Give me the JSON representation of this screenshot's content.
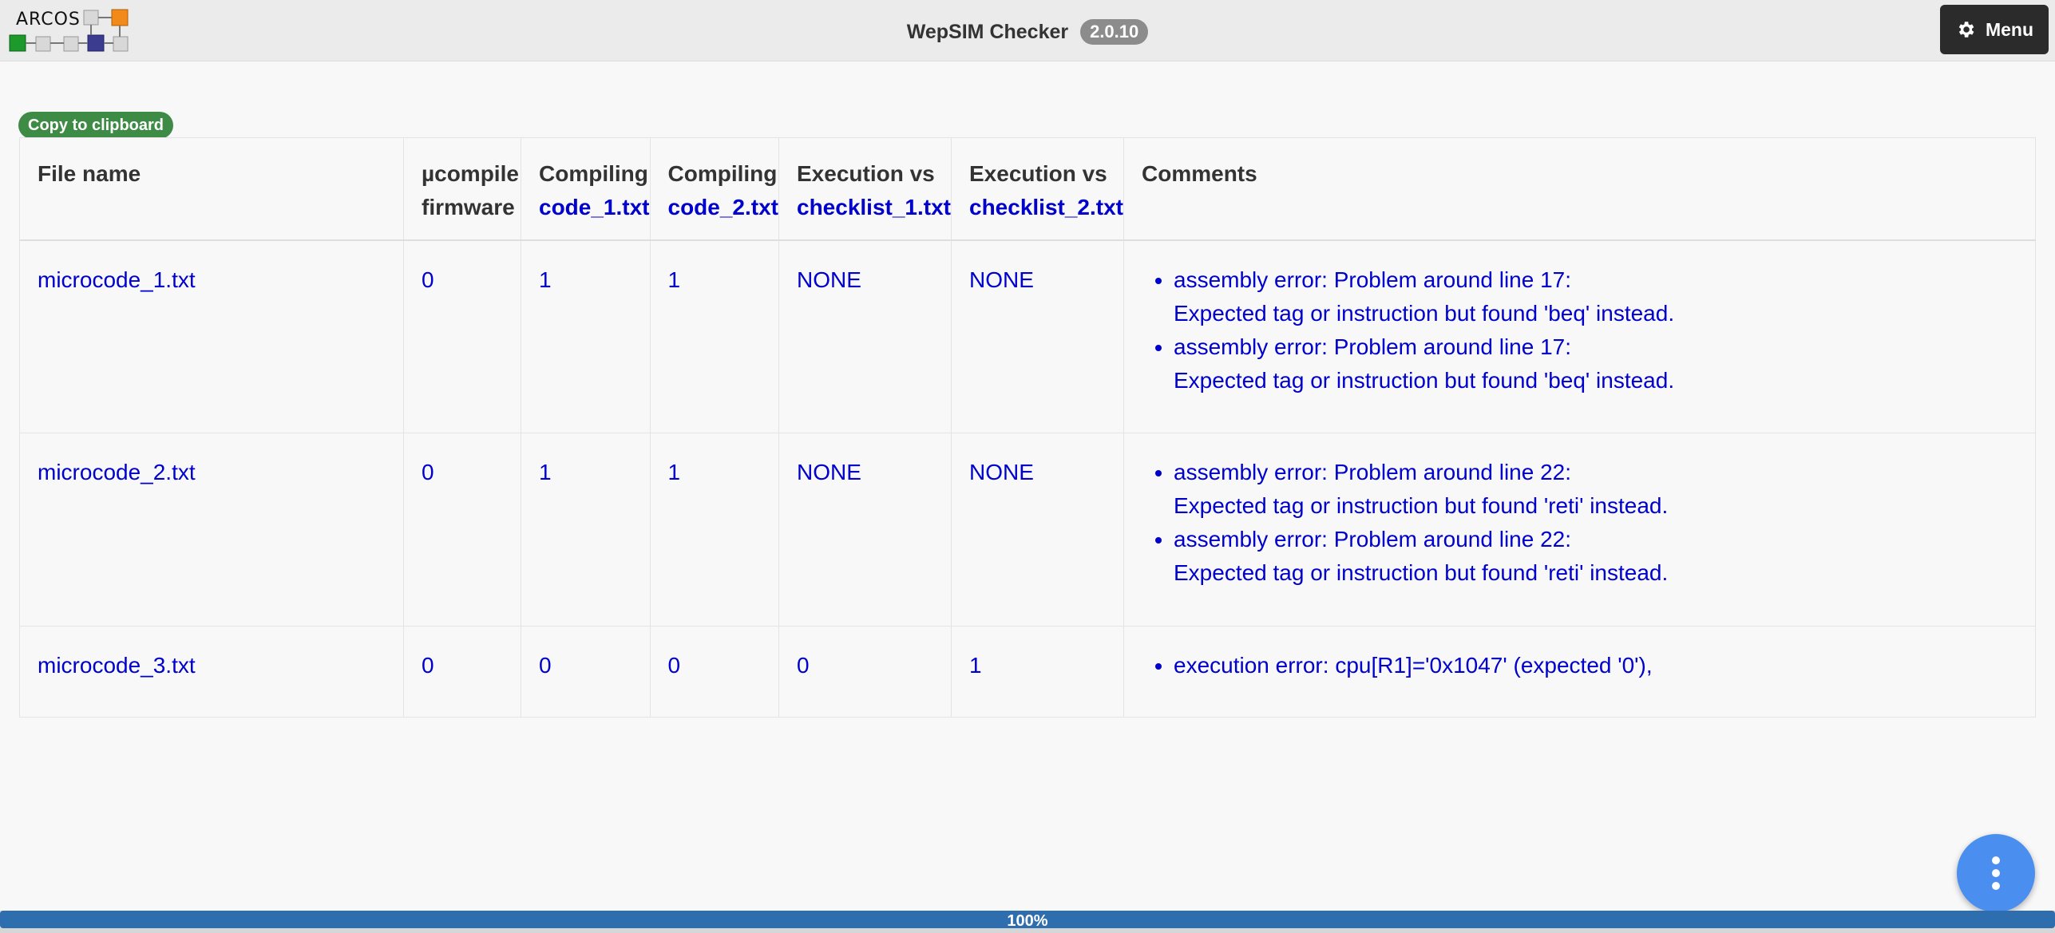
{
  "header": {
    "logo_text": "ARCOS",
    "title": "WepSIM Checker",
    "version": "2.0.10",
    "menu_label": "Menu",
    "menu_icon": "gear-icon"
  },
  "toolbar": {
    "copy_label": "Copy to clipboard"
  },
  "table": {
    "headers": {
      "file": "File name",
      "ucomp_line1": "µcompile",
      "ucomp_line2": "firmware",
      "c1_line1": "Compiling",
      "c1_link": "code_1.txt",
      "c2_line1": "Compiling",
      "c2_link": "code_2.txt",
      "e1_line1": "Execution vs",
      "e1_link": "checklist_1.txt",
      "e2_line1": "Execution vs",
      "e2_link": "checklist_2.txt",
      "comments": "Comments"
    },
    "rows": [
      {
        "file": "microcode_1.txt",
        "ucompile": "0",
        "compile1": "1",
        "compile2": "1",
        "exec1": "NONE",
        "exec2": "NONE",
        "comments": [
          {
            "line1": "assembly error: Problem around line 17:",
            "line2": "Expected tag or instruction but found 'beq' instead."
          },
          {
            "line1": "assembly error: Problem around line 17:",
            "line2": "Expected tag or instruction but found 'beq' instead."
          }
        ]
      },
      {
        "file": "microcode_2.txt",
        "ucompile": "0",
        "compile1": "1",
        "compile2": "1",
        "exec1": "NONE",
        "exec2": "NONE",
        "comments": [
          {
            "line1": "assembly error: Problem around line 22:",
            "line2": "Expected tag or instruction but found 'reti' instead."
          },
          {
            "line1": "assembly error: Problem around line 22:",
            "line2": "Expected tag or instruction but found 'reti' instead."
          }
        ]
      },
      {
        "file": "microcode_3.txt",
        "ucompile": "0",
        "compile1": "0",
        "compile2": "0",
        "exec1": "0",
        "exec2": "1",
        "comments": [
          {
            "line1": "execution error: cpu[R1]='0x1047' (expected '0'),",
            "line2": ""
          }
        ]
      }
    ]
  },
  "fab": {
    "icon": "more-vertical-icon"
  },
  "progress": {
    "label": "100%",
    "value": 1.0
  },
  "colors": {
    "link": "#0000cc",
    "copy_button": "#3e8b45",
    "fab": "#4a8ff0",
    "progress": "#2f6eae",
    "menu": "#2b2b2b"
  }
}
